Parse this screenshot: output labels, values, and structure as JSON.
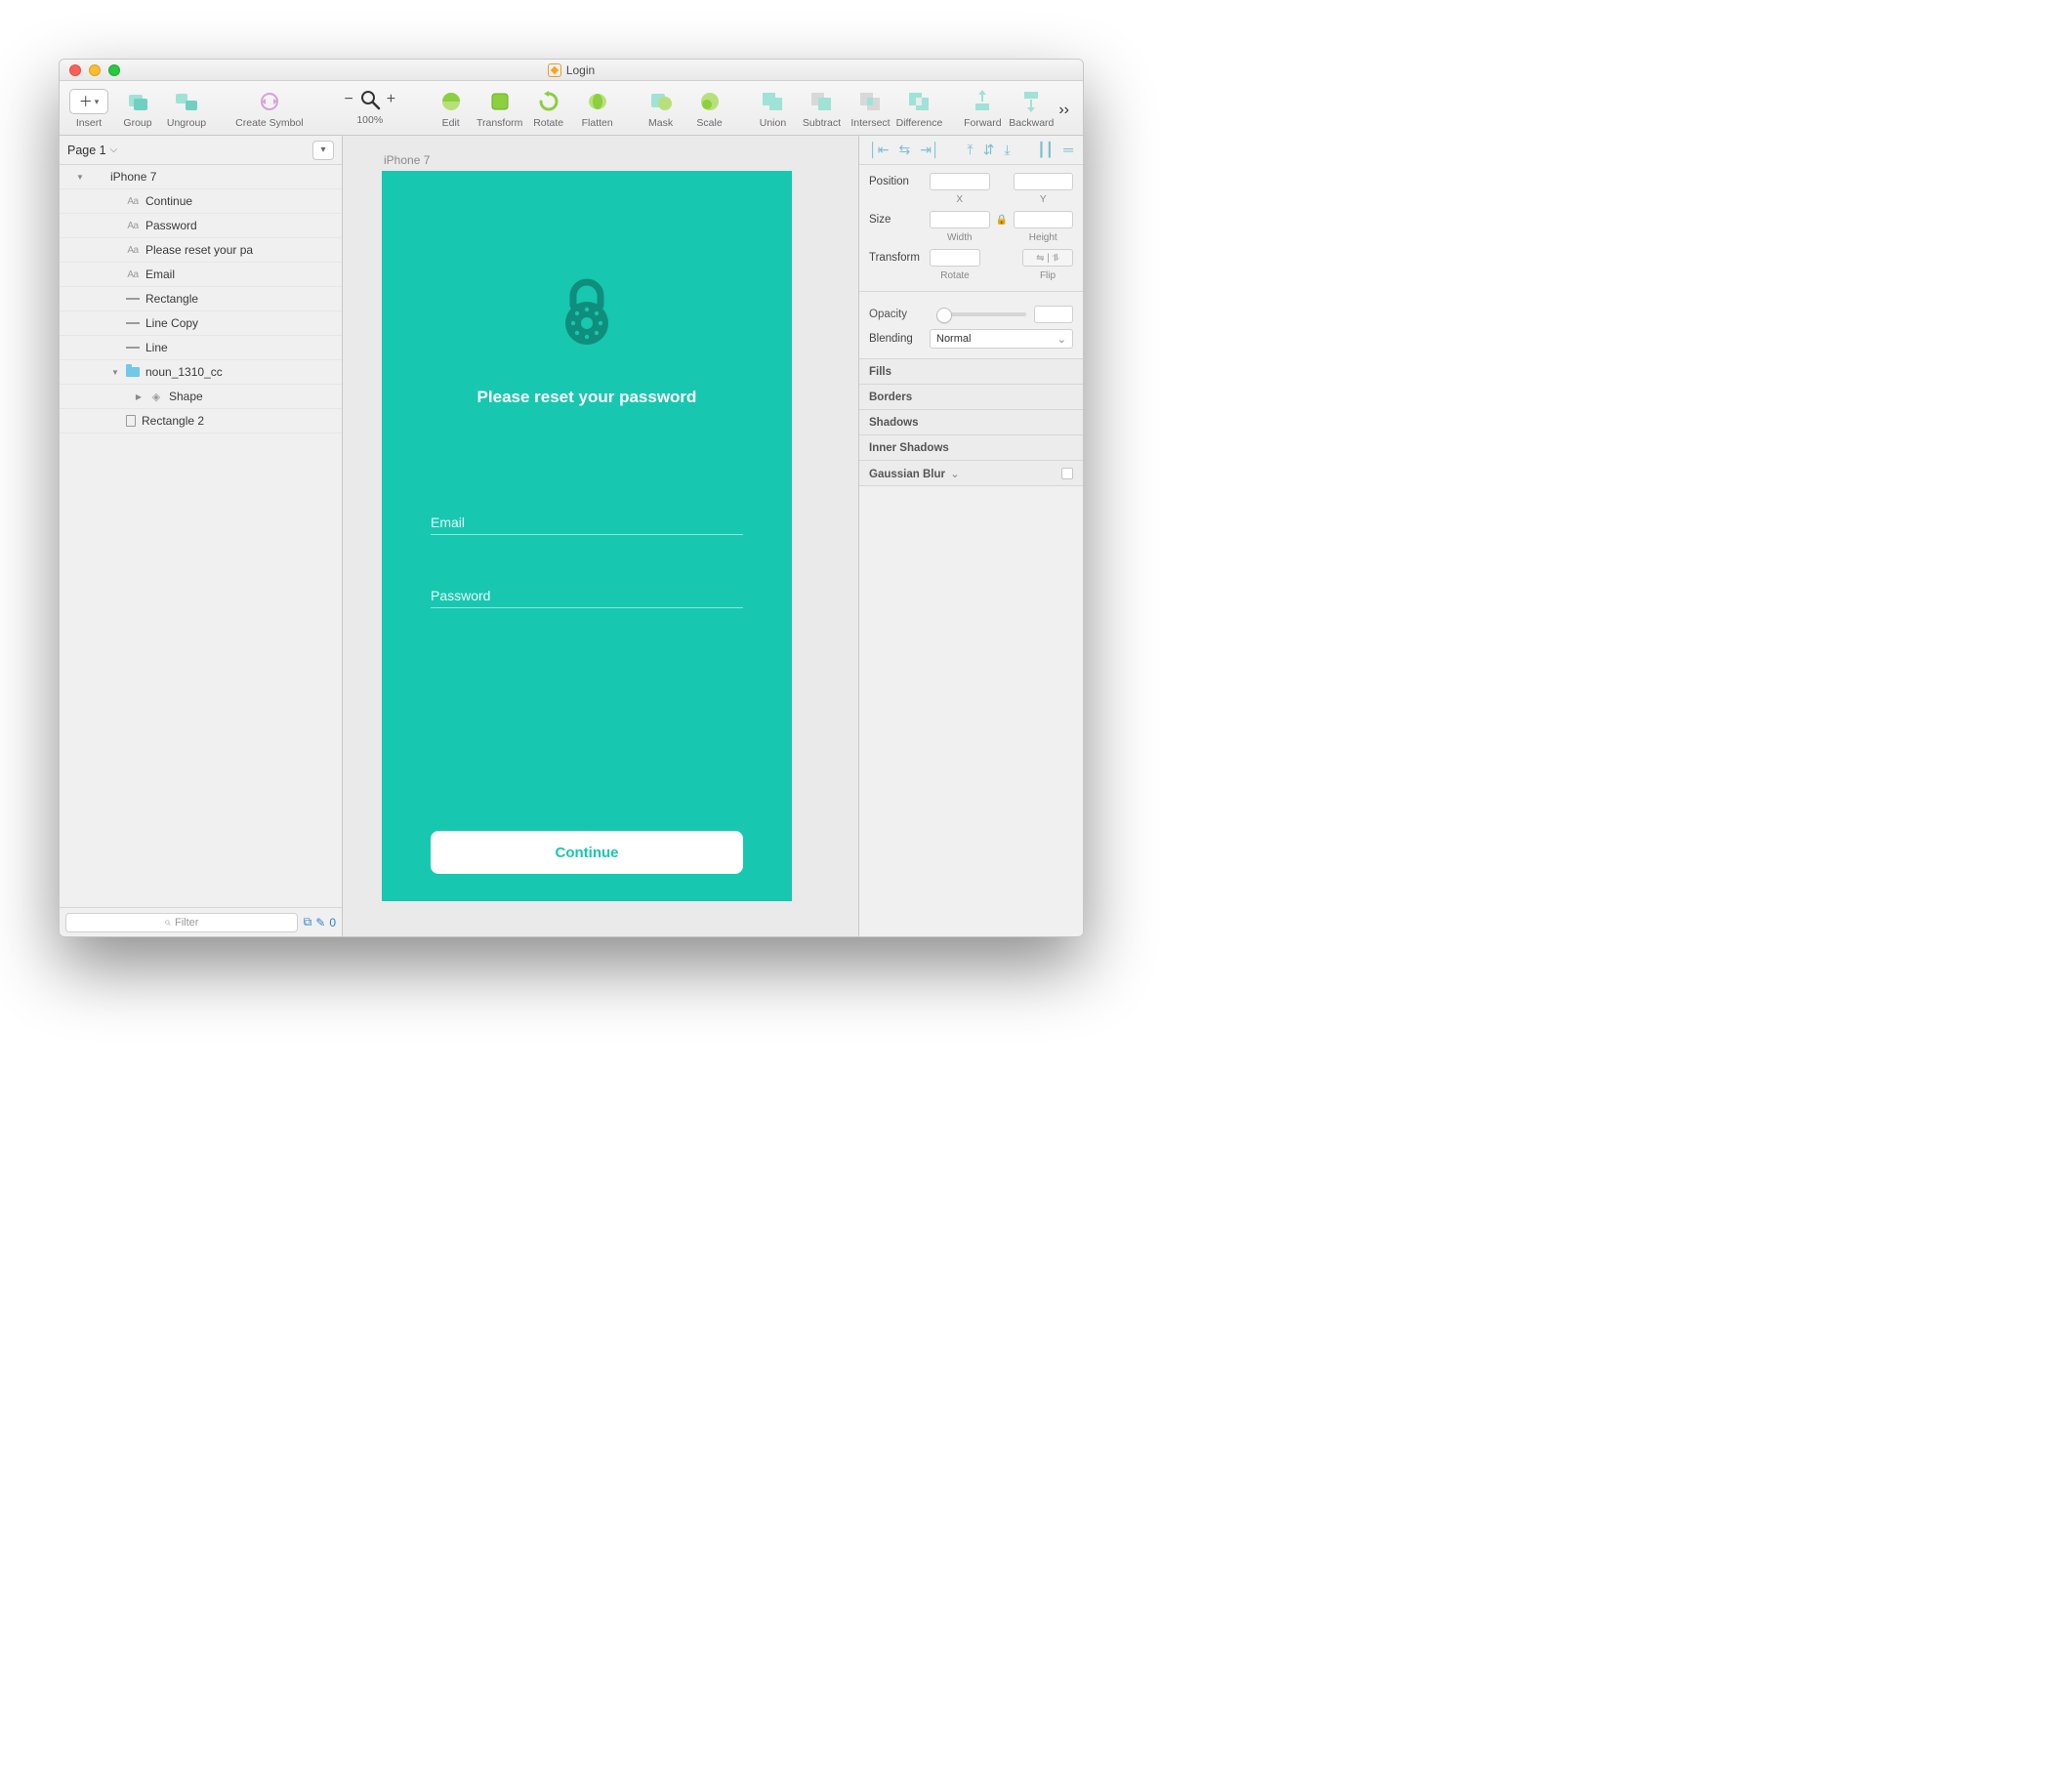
{
  "window": {
    "title": "Login"
  },
  "toolbar": {
    "insert": "Insert",
    "group": "Group",
    "ungroup": "Ungroup",
    "create_symbol": "Create Symbol",
    "zoom": "100%",
    "edit": "Edit",
    "transform": "Transform",
    "rotate": "Rotate",
    "flatten": "Flatten",
    "mask": "Mask",
    "scale": "Scale",
    "union": "Union",
    "subtract": "Subtract",
    "intersect": "Intersect",
    "difference": "Difference",
    "forward": "Forward",
    "backward": "Backward"
  },
  "pages": {
    "current": "Page 1"
  },
  "layers": [
    {
      "depth": 0,
      "disc": "open",
      "icon": "none",
      "label": "iPhone 7"
    },
    {
      "depth": 1,
      "disc": "none",
      "icon": "aa",
      "label": "Continue"
    },
    {
      "depth": 1,
      "disc": "none",
      "icon": "aa",
      "label": "Password"
    },
    {
      "depth": 1,
      "disc": "none",
      "icon": "aa",
      "label": "Please reset your pa"
    },
    {
      "depth": 1,
      "disc": "none",
      "icon": "aa",
      "label": "Email"
    },
    {
      "depth": 1,
      "disc": "none",
      "icon": "line",
      "label": "Rectangle"
    },
    {
      "depth": 1,
      "disc": "none",
      "icon": "line",
      "label": "Line Copy"
    },
    {
      "depth": 1,
      "disc": "none",
      "icon": "line",
      "label": "Line"
    },
    {
      "depth": 1,
      "disc": "open",
      "icon": "folder",
      "label": "noun_1310_cc"
    },
    {
      "depth": 2,
      "disc": "closed",
      "icon": "shape",
      "label": "Shape"
    },
    {
      "depth": 1,
      "disc": "none",
      "icon": "rect",
      "label": "Rectangle 2"
    }
  ],
  "filter": {
    "placeholder": "Filter",
    "count": "0"
  },
  "canvas": {
    "artboard_name": "iPhone 7",
    "heading": "Please reset your password",
    "email_label": "Email",
    "password_label": "Password",
    "cta_label": "Continue",
    "bg_color": "#17c7b0"
  },
  "inspector": {
    "position": "Position",
    "x": "X",
    "y": "Y",
    "size": "Size",
    "width": "Width",
    "height": "Height",
    "transform": "Transform",
    "rotate": "Rotate",
    "flip": "Flip",
    "opacity": "Opacity",
    "blending": "Blending",
    "blending_value": "Normal",
    "fills": "Fills",
    "borders": "Borders",
    "shadows": "Shadows",
    "inner_shadows": "Inner Shadows",
    "gaussian": "Gaussian Blur"
  }
}
